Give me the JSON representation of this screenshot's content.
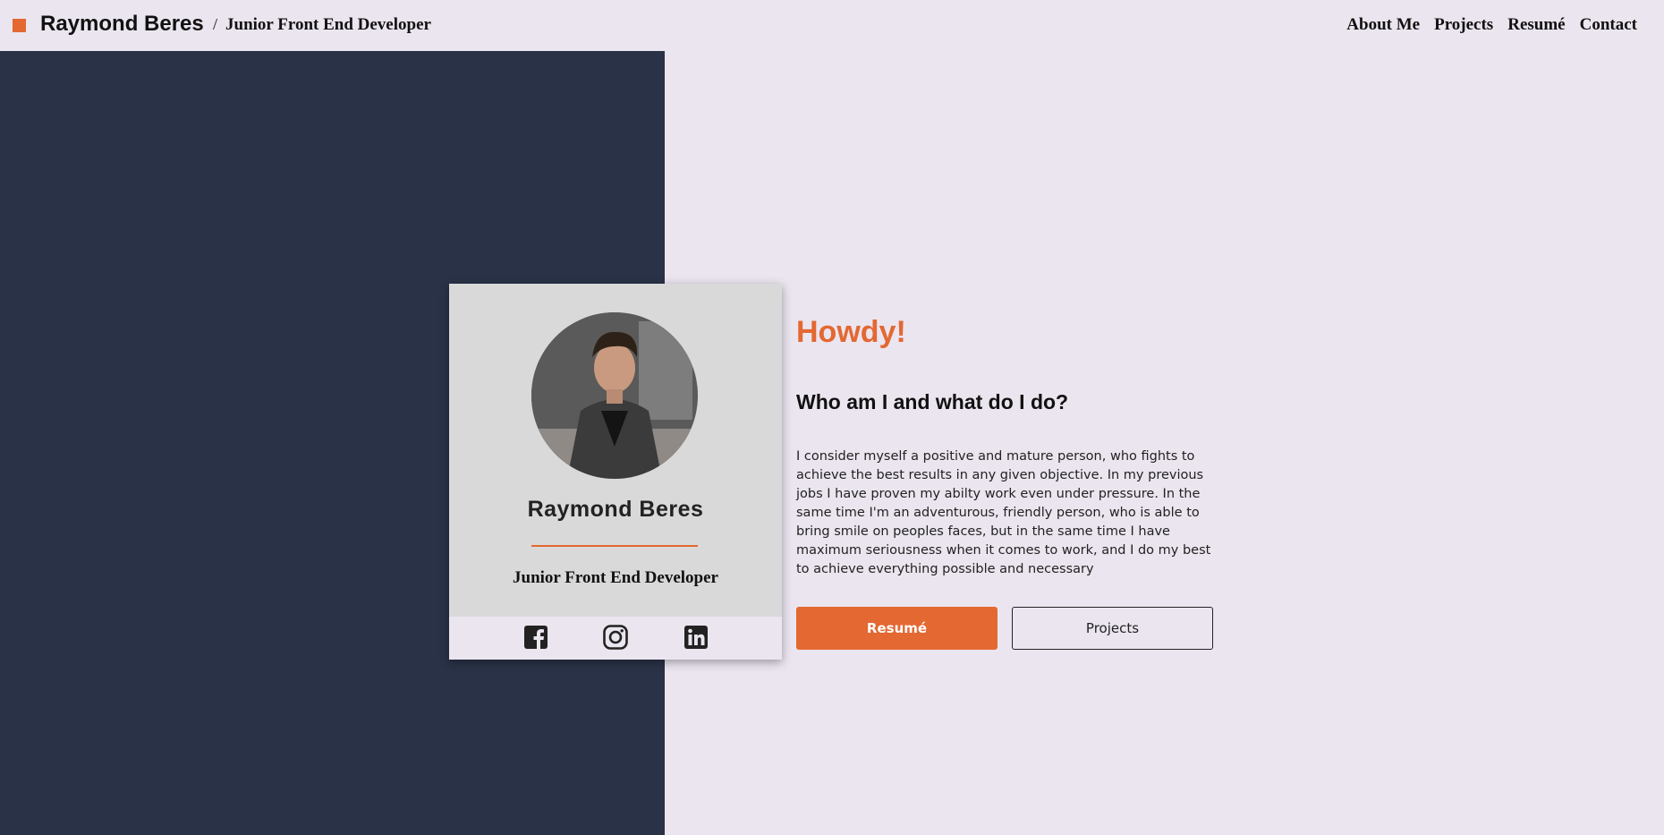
{
  "header": {
    "brand_name": "Raymond Beres",
    "separator": "/",
    "brand_role": "Junior Front End Developer",
    "nav": [
      "About Me",
      "Projects",
      "Resumé",
      "Contact"
    ]
  },
  "card": {
    "name": "Raymond Beres",
    "role": "Junior Front End Developer",
    "social": [
      "facebook-icon",
      "instagram-icon",
      "linkedin-icon"
    ]
  },
  "intro": {
    "greeting": "Howdy!",
    "heading": "Who am I and what do I do?",
    "bio": "I consider myself a positive and mature person, who fights to achieve the best results in any given objective. In my previous jobs I have proven my abilty work even under pressure. In the same time I'm an adventurous, friendly person, who is able to bring smile on peoples faces, but in the same time I have maximum seriousness when it comes to work, and I do my best to achieve everything possible and necessary",
    "primary_button": "Resumé",
    "secondary_button": "Projects"
  },
  "colors": {
    "accent": "#e36832",
    "dark_panel": "#2a3247",
    "background": "#ebe5ef",
    "card": "#d9d9d9"
  }
}
